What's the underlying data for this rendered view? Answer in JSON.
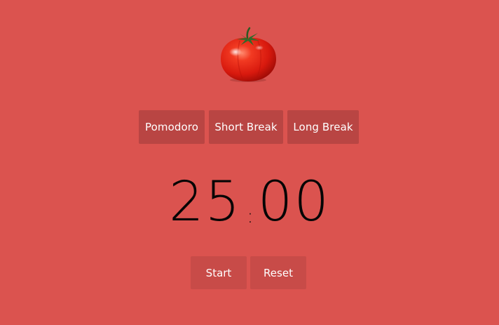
{
  "app": {
    "logo_icon": "tomato-icon",
    "background_color": "#db534f",
    "tab_color": "#b94543",
    "button_color": "#c84b48"
  },
  "tabs": [
    {
      "label": "Pomodoro"
    },
    {
      "label": "Short Break"
    },
    {
      "label": "Long Break"
    }
  ],
  "timer": {
    "minutes": "25",
    "separator": ":",
    "seconds": "00"
  },
  "controls": {
    "start_label": "Start",
    "reset_label": "Reset"
  }
}
